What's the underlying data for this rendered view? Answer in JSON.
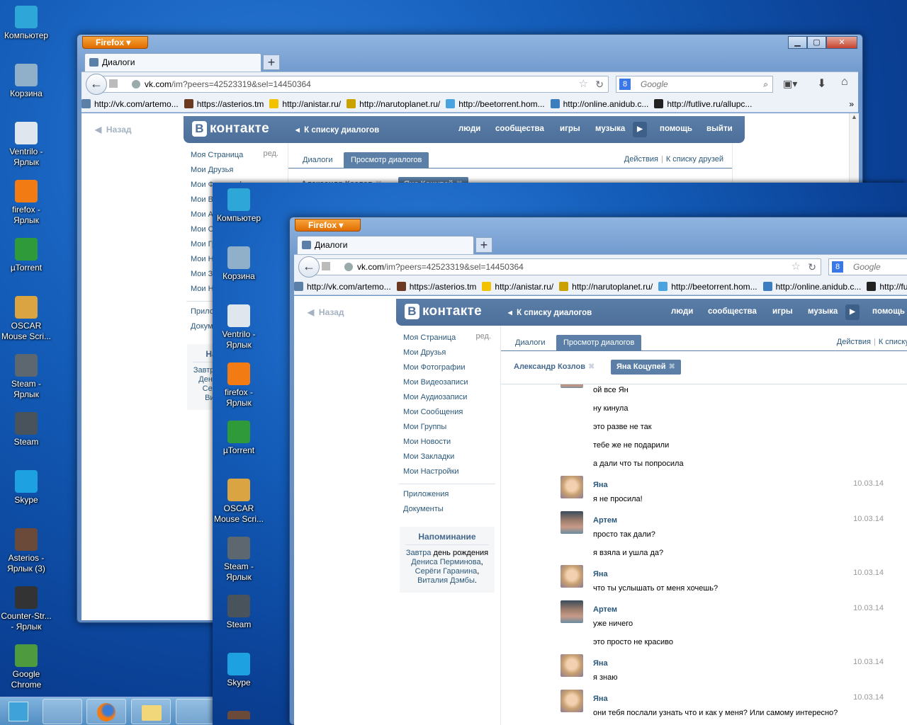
{
  "desktop_icons": [
    {
      "label": "Компьютер",
      "icon": "computer-icon"
    },
    {
      "label": "Корзина",
      "icon": "recycle-bin-icon"
    },
    {
      "label": "Ventrilo - Ярлык",
      "icon": "ventrilo-icon"
    },
    {
      "label": "firefox - Ярлык",
      "icon": "firefox-icon"
    },
    {
      "label": "µTorrent",
      "icon": "utorrent-icon"
    },
    {
      "label": "OSCAR Mouse Scri...",
      "icon": "oscar-icon"
    },
    {
      "label": "Steam - Ярлык",
      "icon": "steam-icon"
    },
    {
      "label": "Steam",
      "icon": "steam-icon"
    },
    {
      "label": "Skype",
      "icon": "skype-icon"
    },
    {
      "label": "Asterios - Ярлык (3)",
      "icon": "asterios-icon"
    },
    {
      "label": "Counter-Str... - Ярлык",
      "icon": "counter-strike-icon"
    },
    {
      "label": "Google Chrome",
      "icon": "chrome-icon"
    }
  ],
  "browser": {
    "menu_button": "Firefox",
    "tab_title": "Диалоги",
    "url_host": "vk.com",
    "url_path": "/im?peers=42523319&sel=14450364",
    "search_placeholder": "Google",
    "bookmarks": [
      "http://vk.com/artemo...",
      "https://asterios.tm",
      "http://anistar.ru/",
      "http://narutoplanet.ru/",
      "http://beetorrent.hom...",
      "http://online.anidub.c...",
      "http://futlive.ru/allupc..."
    ]
  },
  "vk": {
    "back": "Назад",
    "logo_letter": "В",
    "logo_text": "контакте",
    "to_dialogs": "К списку диалогов",
    "nav": [
      "люди",
      "сообщества",
      "игры",
      "музыка",
      "помощь",
      "выйти"
    ],
    "edit": "ред.",
    "menu": [
      "Моя Страница",
      "Мои Друзья",
      "Мои Фотографии",
      "Мои Видеозаписи",
      "Мои Аудиозаписи",
      "Мои Сообщения",
      "Мои Группы",
      "Мои Новости",
      "Мои Закладки",
      "Мои Настройки"
    ],
    "menu2": [
      "Приложения",
      "Документы"
    ],
    "reminder": {
      "title": "Напоминание",
      "p1": "Завтра",
      "p2": "день рождения",
      "p3": "Дениса Перминова",
      "p4": ",",
      "p5": "Серёги Гаранина",
      "p6": ",",
      "p7": "Виталия Дэмбы",
      "p8": "."
    },
    "tabs": [
      "Диалоги",
      "Просмотр диалогов"
    ],
    "actions": "Действия",
    "to_friends": "К списку друзей",
    "chips": [
      "Александр Козлов",
      "Яна Коцупей"
    ],
    "messages": [
      {
        "author": "",
        "date": "",
        "avatar": "artem",
        "lines": [
          "ой все Ян",
          "ну кинула",
          "это разве не так",
          "тебе же не подарили",
          "а дали что ты попросила"
        ]
      },
      {
        "author": "Яна",
        "date": "10.03.14",
        "avatar": "yana",
        "lines": [
          "я не просила!"
        ]
      },
      {
        "author": "Артем",
        "date": "10.03.14",
        "avatar": "artem",
        "lines": [
          "просто так дали?",
          "я взяла и ушла да?"
        ]
      },
      {
        "author": "Яна",
        "date": "10.03.14",
        "avatar": "yana",
        "lines": [
          "что ты услышать от меня хочешь?"
        ]
      },
      {
        "author": "Артем",
        "date": "10.03.14",
        "avatar": "artem",
        "lines": [
          "уже ничего",
          "это просто не красиво"
        ]
      },
      {
        "author": "Яна",
        "date": "10.03.14",
        "avatar": "yana",
        "lines": [
          "я знаю"
        ]
      },
      {
        "author": "Яна",
        "date": "10.03.14",
        "avatar": "yana",
        "lines": [
          "они тебя послали узнать что и как у меня? Или самому интересно?"
        ]
      }
    ]
  },
  "colors": {
    "vk_blue": "#5b7fa6",
    "link": "#2b587a",
    "firefox_orange": "#e97c0c"
  }
}
